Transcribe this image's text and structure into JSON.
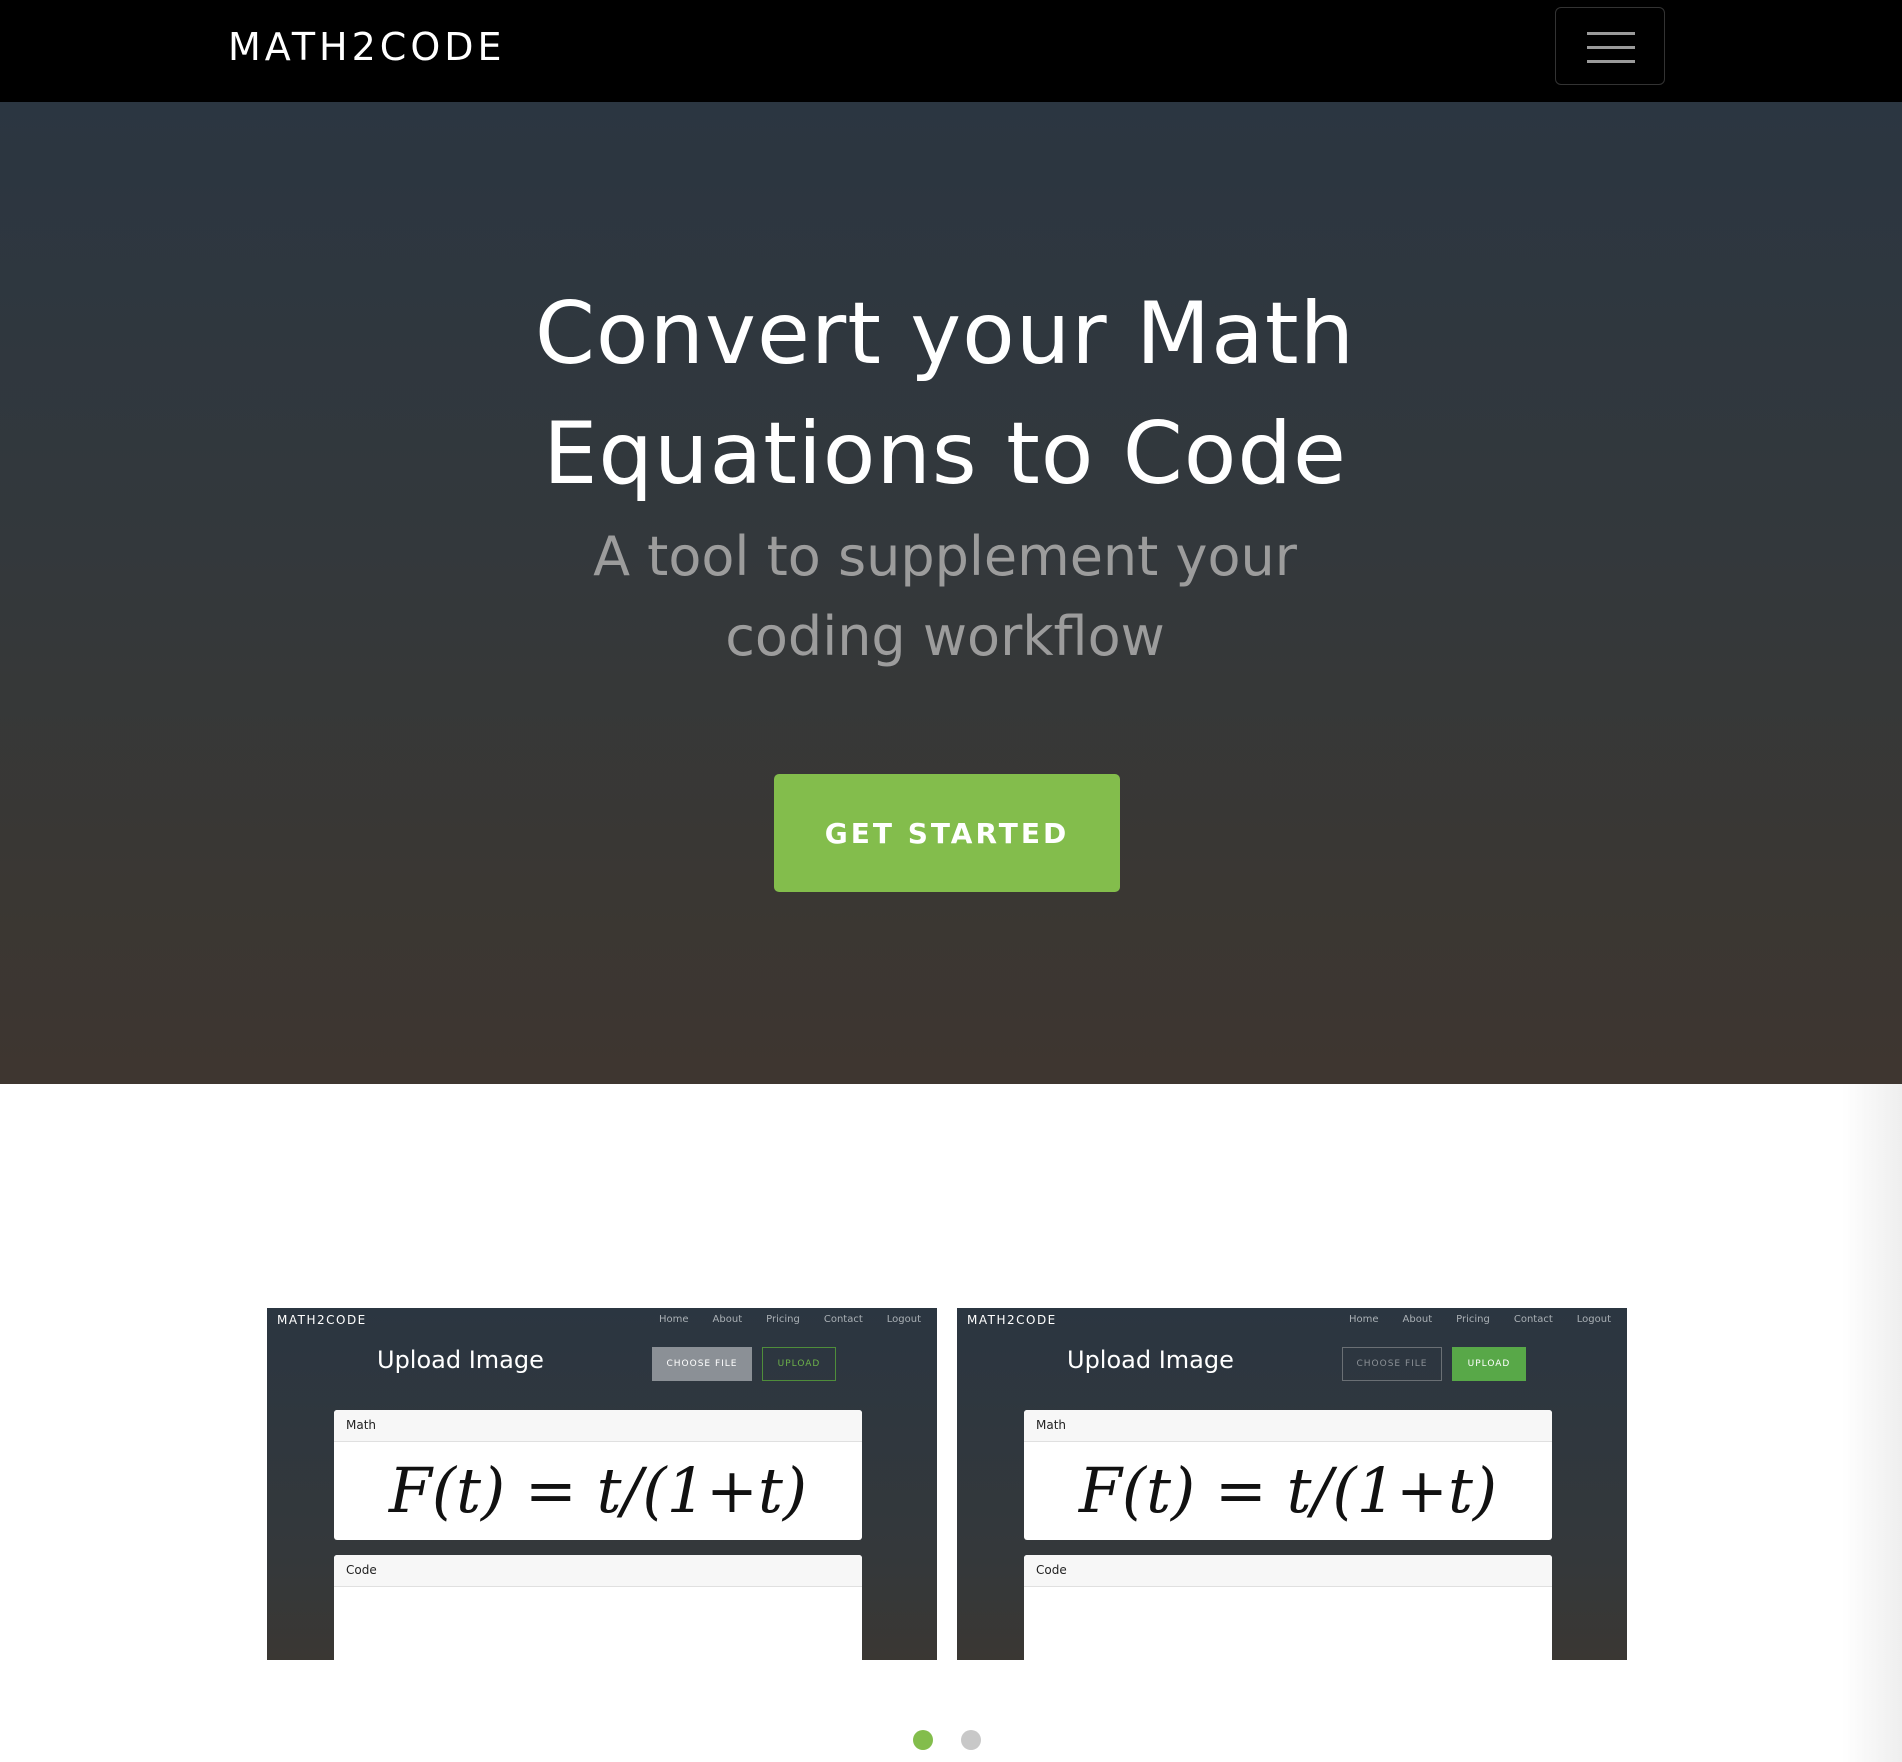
{
  "navbar": {
    "brand": "MATH2CODE",
    "menu_icon": "hamburger-menu-icon"
  },
  "hero": {
    "title_line1": "Convert your Math",
    "title_line2": "Equations to Code",
    "subtitle_line1": "A tool to supplement your",
    "subtitle_line2": "coding workflow",
    "cta_label": "GET STARTED"
  },
  "colors": {
    "accent": "#83bd4c",
    "navbar_bg": "#000000",
    "subtitle": "#9c9c9c"
  },
  "carousel": {
    "slides": [
      {
        "brand": "MATH2CODE",
        "nav": [
          "Home",
          "About",
          "Pricing",
          "Contact",
          "Logout"
        ],
        "title": "Upload Image",
        "choose_file_label": "CHOOSE FILE",
        "upload_label": "UPLOAD",
        "math_header": "Math",
        "equation": "F(t) = t/(1+t)",
        "code_header": "Code",
        "active_button": "choose-file"
      },
      {
        "brand": "MATH2CODE",
        "nav": [
          "Home",
          "About",
          "Pricing",
          "Contact",
          "Logout"
        ],
        "title": "Upload Image",
        "choose_file_label": "CHOOSE FILE",
        "upload_label": "UPLOAD",
        "math_header": "Math",
        "equation": "F(t) = t/(1+t)",
        "code_header": "Code",
        "active_button": "upload"
      }
    ],
    "indicators": {
      "count": 2,
      "active_index": 0
    }
  }
}
